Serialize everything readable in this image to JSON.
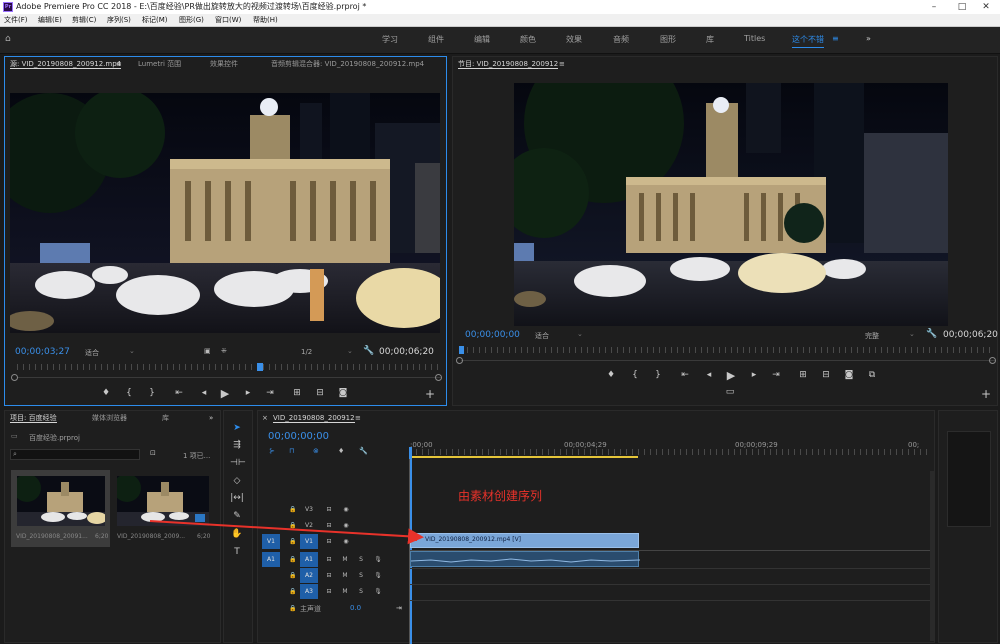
{
  "title_bar": {
    "app_icon_text": "Pr",
    "title": "Adobe Premiere Pro CC 2018 - E:\\百度经验\\PR做出旋转放大的视频过渡转场\\百度经验.prproj *"
  },
  "menu": [
    "文件(F)",
    "编辑(E)",
    "剪辑(C)",
    "序列(S)",
    "标记(M)",
    "图形(G)",
    "窗口(W)",
    "帮助(H)"
  ],
  "workspaces": {
    "items": [
      "学习",
      "组件",
      "编辑",
      "颜色",
      "效果",
      "音频",
      "图形",
      "库",
      "Titles",
      "这个不错"
    ],
    "active": "这个不错",
    "menu_icon": "≡",
    "more": "»"
  },
  "source_monitor": {
    "tabs": [
      "源: VID_20190808_200912.mp4",
      "Lumetri 范围",
      "效果控件",
      "音频剪辑混合器: VID_20190808_200912.mp4"
    ],
    "tab_menu_icon": "≡",
    "timecode_in": "00;00;03;27",
    "fit": "适合",
    "resolution": "1/2",
    "duration": "00;00;06;20",
    "add_icon": "+"
  },
  "program_monitor": {
    "tab": "节目: VID_20190808_200912",
    "tab_menu_icon": "≡",
    "timecode": "00;00;00;00",
    "fit": "适合",
    "quality": "完整",
    "duration": "00;00;06;20",
    "add_icon": "+"
  },
  "project_panel": {
    "tabs": [
      "项目: 百度经验",
      "媒体浏览器",
      "库"
    ],
    "more": "»",
    "project_file": "百度经验.prproj",
    "item_count": "1 项已...",
    "items": [
      {
        "name": "VID_20190808_20091...",
        "duration": "6;20"
      },
      {
        "name": "VID_20190808_2009...",
        "duration": "6;20"
      }
    ]
  },
  "timeline": {
    "tab": "VID_20190808_200912",
    "close": "×",
    "tab_menu_icon": "≡",
    "timecode": "00;00;00;00",
    "ruler": [
      ";00;00",
      "00;00;04;29",
      "00;00;09;29",
      "00;"
    ],
    "annotation": "由素材创建序列",
    "annotation_color": "#e8322a",
    "clip_video": "VID_20190808_200912.mp4 [V]",
    "video_tracks": [
      "V3",
      "V2",
      "V1"
    ],
    "audio_tracks": [
      "A1",
      "A2",
      "A3"
    ],
    "source_patch_v": "V1",
    "source_patch_a": "A1",
    "master_label": "主声道",
    "master_value": "0.0",
    "mute": "M",
    "solo": "S"
  },
  "colors": {
    "accent": "#2d8ceb",
    "clip": "#7aa6d8",
    "track_select": "#1f5fa8"
  }
}
